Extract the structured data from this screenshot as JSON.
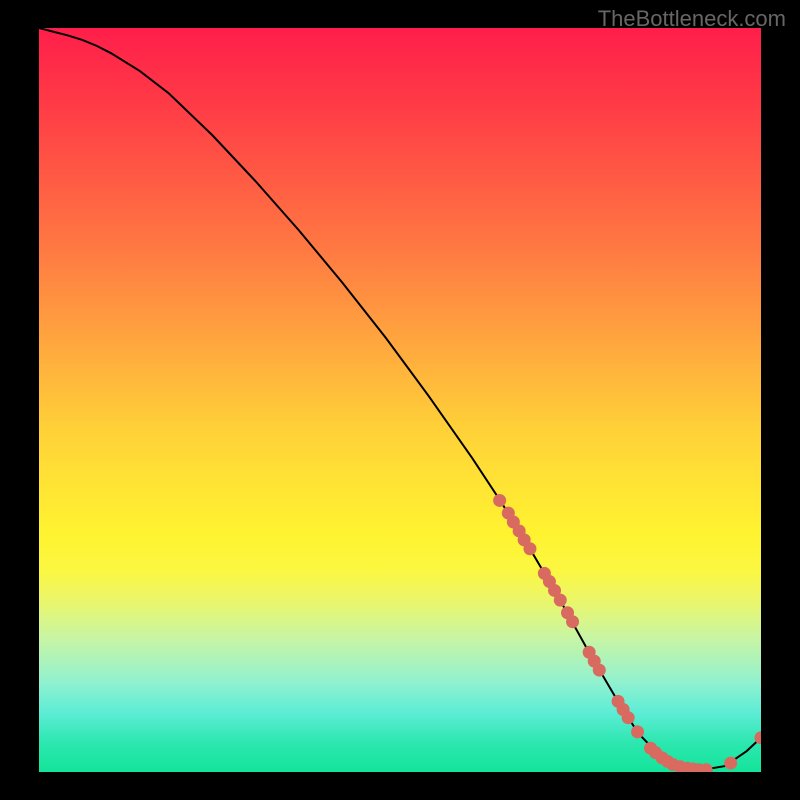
{
  "watermark": "TheBottleneck.com",
  "chart_data": {
    "type": "line",
    "title": "",
    "xlabel": "",
    "ylabel": "",
    "xlim": [
      0,
      100
    ],
    "ylim": [
      0,
      100
    ],
    "series": [
      {
        "name": "curve",
        "x": [
          0,
          2,
          4,
          6,
          8,
          10,
          14,
          18,
          24,
          30,
          36,
          42,
          48,
          54,
          60,
          64,
          68,
          72,
          76,
          80,
          83,
          86,
          89,
          92,
          95,
          98,
          100
        ],
        "y": [
          100,
          99.5,
          99,
          98.4,
          97.6,
          96.6,
          94.2,
          91.2,
          85.6,
          79.4,
          72.8,
          65.8,
          58.4,
          50.5,
          42.2,
          36.3,
          30,
          23.4,
          16.4,
          9.8,
          5.2,
          2.2,
          0.8,
          0.3,
          0.8,
          2.8,
          4.6
        ]
      }
    ],
    "scatter": {
      "name": "markers",
      "color": "#d86a60",
      "points": [
        {
          "x": 63.8,
          "y": 36.5
        },
        {
          "x": 65.0,
          "y": 34.8
        },
        {
          "x": 65.7,
          "y": 33.6
        },
        {
          "x": 66.5,
          "y": 32.4
        },
        {
          "x": 67.2,
          "y": 31.2
        },
        {
          "x": 68.0,
          "y": 30.0
        },
        {
          "x": 70.0,
          "y": 26.7
        },
        {
          "x": 70.7,
          "y": 25.6
        },
        {
          "x": 71.4,
          "y": 24.4
        },
        {
          "x": 72.2,
          "y": 23.1
        },
        {
          "x": 73.2,
          "y": 21.4
        },
        {
          "x": 73.9,
          "y": 20.2
        },
        {
          "x": 76.2,
          "y": 16.1
        },
        {
          "x": 76.9,
          "y": 14.9
        },
        {
          "x": 77.6,
          "y": 13.7
        },
        {
          "x": 80.2,
          "y": 9.5
        },
        {
          "x": 80.9,
          "y": 8.4
        },
        {
          "x": 81.6,
          "y": 7.3
        },
        {
          "x": 82.9,
          "y": 5.4
        },
        {
          "x": 84.7,
          "y": 3.2
        },
        {
          "x": 85.4,
          "y": 2.6
        },
        {
          "x": 86.3,
          "y": 1.9
        },
        {
          "x": 87.1,
          "y": 1.4
        },
        {
          "x": 87.8,
          "y": 1.0
        },
        {
          "x": 88.8,
          "y": 0.7
        },
        {
          "x": 89.8,
          "y": 0.5
        },
        {
          "x": 90.6,
          "y": 0.4
        },
        {
          "x": 91.4,
          "y": 0.3
        },
        {
          "x": 92.4,
          "y": 0.3
        },
        {
          "x": 95.8,
          "y": 1.2
        },
        {
          "x": 100.0,
          "y": 4.6
        }
      ]
    }
  }
}
